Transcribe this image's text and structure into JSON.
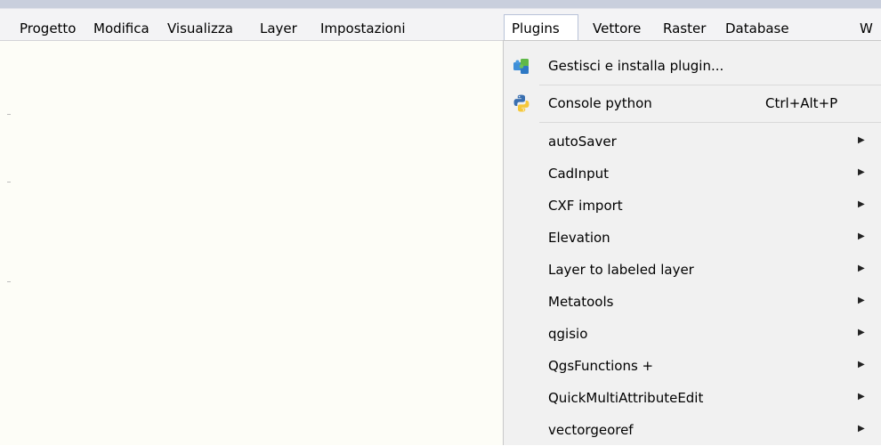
{
  "menubar": {
    "items": [
      "Progetto",
      "Modifica",
      "Visualizza",
      "Layer",
      "Impostazioni",
      "Plugins",
      "Vettore",
      "Raster",
      "Database",
      "W"
    ]
  },
  "plugins_menu": {
    "manage_label": "Gestisci e installa plugin...",
    "console_label": "Console python",
    "console_shortcut": "Ctrl+Alt+P",
    "submenus": [
      "autoSaver",
      "CadInput",
      "CXF import",
      "Elevation",
      "Layer to labeled layer",
      "Metatools",
      "qgisio",
      "QgsFunctions +",
      "QuickMultiAttributeEdit",
      "vectorgeoref"
    ]
  },
  "icons": {
    "manage": "puzzle-plugin-icon",
    "console": "python-icon",
    "submenu": "chevron-right-icon"
  }
}
